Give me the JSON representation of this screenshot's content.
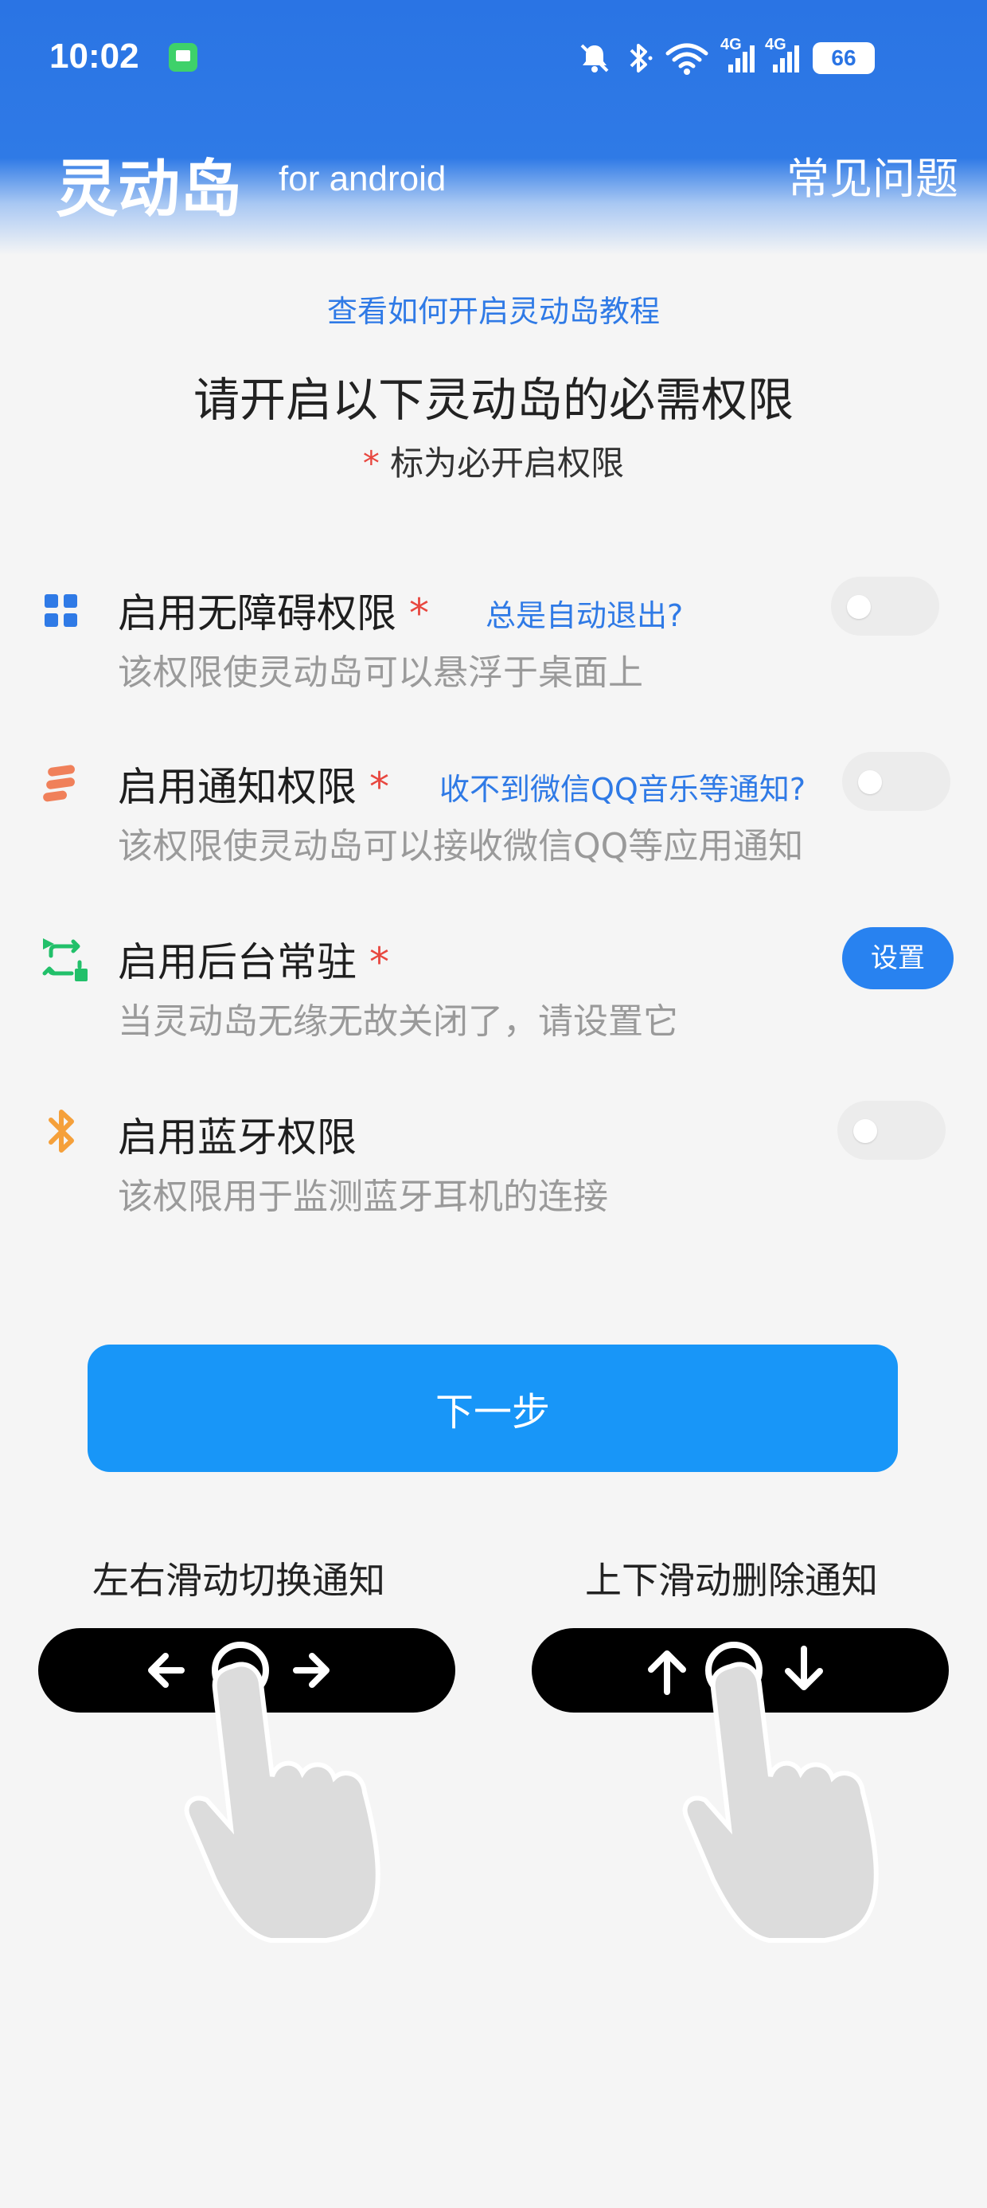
{
  "status_bar": {
    "time": "10:02",
    "battery": "66",
    "signal_1": "4G",
    "signal_2": "4G",
    "icons": [
      "chat-app-icon",
      "mute-icon",
      "bluetooth-icon",
      "wifi-icon",
      "signal-icon",
      "battery-icon"
    ]
  },
  "header": {
    "title": "灵动岛",
    "subtitle": "for android",
    "faq": "常见问题"
  },
  "intro": {
    "tutorial_link": "查看如何开启灵动岛教程",
    "title": "请开启以下灵动岛的必需权限",
    "required_star": "*",
    "required_note": "标为必开启权限"
  },
  "permissions": [
    {
      "icon": "grid-icon",
      "title": "启用无障碍权限",
      "required": "*",
      "help": "总是自动退出?",
      "description": "该权限使灵动岛可以悬浮于桌面上",
      "control": "toggle",
      "enabled": false
    },
    {
      "icon": "notification-icon",
      "title": "启用通知权限",
      "required": "*",
      "help": "收不到微信QQ音乐等通知?",
      "description": "该权限使灵动岛可以接收微信QQ等应用通知",
      "control": "toggle",
      "enabled": false
    },
    {
      "icon": "background-run-icon",
      "title": "启用后台常驻",
      "required": "*",
      "help": "",
      "description": "当灵动岛无缘无故关闭了，请设置它",
      "control": "button",
      "button_label": "设置"
    },
    {
      "icon": "bluetooth-icon",
      "title": "启用蓝牙权限",
      "required": "",
      "help": "",
      "description": "该权限用于监测蓝牙耳机的连接",
      "control": "toggle",
      "enabled": false
    }
  ],
  "next_button": "下一步",
  "gestures": [
    {
      "label": "左右滑动切换通知",
      "icons": [
        "arrow-left-icon",
        "circle-icon",
        "arrow-right-icon"
      ]
    },
    {
      "label": "上下滑动删除通知",
      "icons": [
        "arrow-up-icon",
        "circle-icon",
        "arrow-down-icon"
      ]
    }
  ],
  "colors": {
    "header_blue": "#2a74e4",
    "link_blue": "#2f7ae6",
    "primary_button": "#1896f8",
    "required_red": "#e8473f",
    "accessibility_icon": "#2f7ae6",
    "notification_icon": "#f0805a",
    "background_icon": "#22c06a",
    "bluetooth_icon": "#f5a03a"
  }
}
